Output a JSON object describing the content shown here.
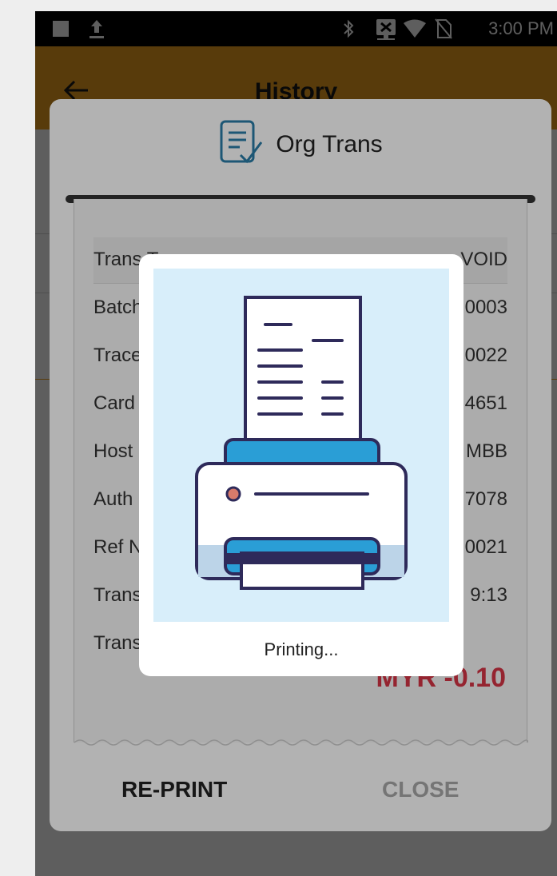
{
  "status_bar": {
    "time": "3:00 PM",
    "left_icons": [
      "square-icon",
      "upload-icon"
    ],
    "right_icons": [
      "bluetooth-icon",
      "network-x-icon",
      "wifi-icon",
      "no-sim-icon"
    ]
  },
  "app_bar": {
    "title": "History",
    "back_icon": "arrow-left-icon",
    "color": "#f0a020"
  },
  "dialog": {
    "title": "Org Trans",
    "title_icon": "checklist-document-icon",
    "rows": [
      {
        "label": "Trans Type",
        "value": "VOID"
      },
      {
        "label": "Batch",
        "value": "0003"
      },
      {
        "label": "Trace",
        "value": "0022"
      },
      {
        "label": "Card",
        "value": "4651"
      },
      {
        "label": "Host",
        "value": "MBB"
      },
      {
        "label": "Auth",
        "value": "7078"
      },
      {
        "label": "Ref No",
        "value": "0021"
      },
      {
        "label": "Trans Time",
        "value": "9:13"
      },
      {
        "label": "Trans Amt",
        "value": ""
      }
    ],
    "total": "MYR -0.10",
    "total_color": "#d63446",
    "reprint_label": "RE-PRINT",
    "close_label": "CLOSE"
  },
  "printing_popup": {
    "text": "Printing...",
    "illustration_icon": "printer-receipt-icon"
  }
}
